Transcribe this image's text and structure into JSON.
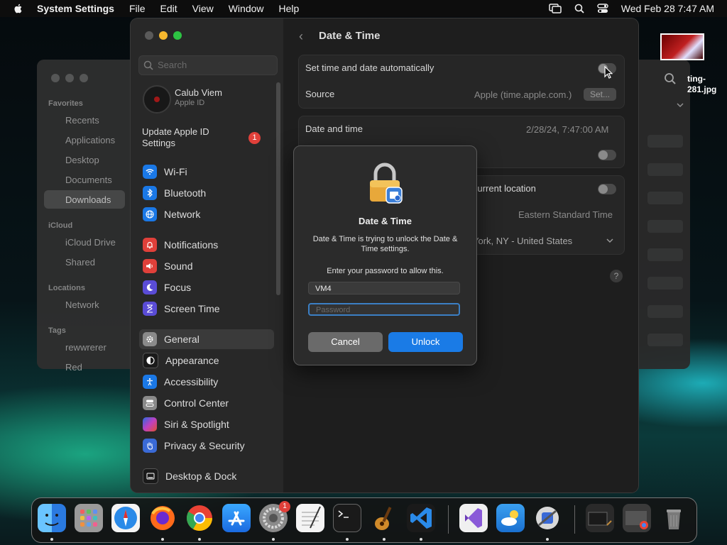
{
  "menubar": {
    "app": "System Settings",
    "items": [
      "File",
      "Edit",
      "View",
      "Window",
      "Help"
    ],
    "clock": "Wed Feb 28  7:47 AM"
  },
  "desktop": {
    "file_label_line1": "ting-",
    "file_label_line2": "281.jpg"
  },
  "finder": {
    "favorites_header": "Favorites",
    "favorites": [
      "Recents",
      "Applications",
      "Desktop",
      "Documents",
      "Downloads"
    ],
    "icloud_header": "iCloud",
    "icloud": [
      "iCloud Drive",
      "Shared"
    ],
    "locations_header": "Locations",
    "locations": [
      "Network"
    ],
    "tags_header": "Tags",
    "tags": [
      "rewwrerer",
      "Red"
    ]
  },
  "sidebar": {
    "search_placeholder": "Search",
    "user_name": "Calub Viem",
    "user_sub": "Apple ID",
    "update_label": "Update Apple ID Settings",
    "update_badge": "1",
    "items": [
      {
        "label": "Wi-Fi",
        "color": "#1a78e6"
      },
      {
        "label": "Bluetooth",
        "color": "#1a78e6"
      },
      {
        "label": "Network",
        "color": "#1a78e6"
      },
      {
        "label": "Notifications",
        "color": "#e0403a"
      },
      {
        "label": "Sound",
        "color": "#e0403a"
      },
      {
        "label": "Focus",
        "color": "#5a4cd6"
      },
      {
        "label": "Screen Time",
        "color": "#5a4cd6"
      },
      {
        "label": "General",
        "color": "#8a8a8a"
      },
      {
        "label": "Appearance",
        "color": "#1a1a1a"
      },
      {
        "label": "Accessibility",
        "color": "#1a78e6"
      },
      {
        "label": "Control Center",
        "color": "#8a8a8a"
      },
      {
        "label": "Siri & Spotlight",
        "color": "#b040c0"
      },
      {
        "label": "Privacy & Security",
        "color": "#3a6ad6"
      },
      {
        "label": "Desktop & Dock",
        "color": "#1a1a1a"
      }
    ]
  },
  "content": {
    "title": "Date & Time",
    "set_auto_label": "Set time and date automatically",
    "source_label": "Source",
    "source_value": "Apple (time.apple.com.)",
    "set_button": "Set...",
    "date_time_label": "Date and time",
    "date_time_value": "2/28/24, 7:47:00 AM",
    "location_label": "current location",
    "timezone_value": "Eastern Standard Time",
    "city_value": "York, NY - United States",
    "help": "?"
  },
  "dialog": {
    "title": "Date & Time",
    "message": "Date & Time is trying to unlock the Date & Time settings.",
    "prompt": "Enter your password to allow this.",
    "username": "VM4",
    "password_placeholder": "Password",
    "cancel": "Cancel",
    "unlock": "Unlock"
  },
  "dock": {
    "settings_badge": "1"
  }
}
